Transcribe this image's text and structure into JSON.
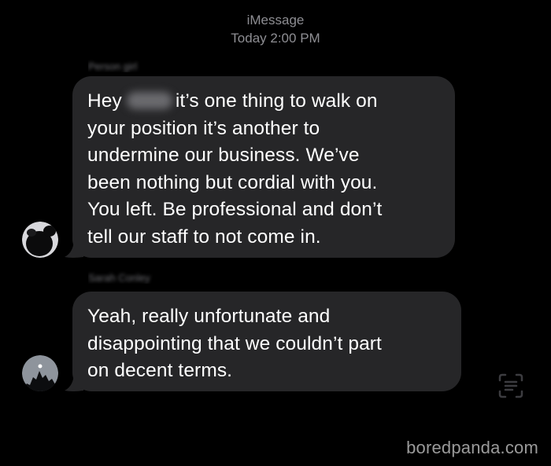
{
  "header": {
    "service": "iMessage",
    "timestamp": "Today 2:00 PM"
  },
  "messages": [
    {
      "sender_name": "Person girl",
      "lines": [
        "Hey",
        "it’s one thing to walk on",
        "your position it’s another to",
        "undermine our business. We’ve",
        "been nothing but cordial with you.",
        "You left. Be professional and don’t",
        "tell our staff to not come in."
      ],
      "has_redacted_name": true
    },
    {
      "sender_name": "Sarah Conley",
      "lines": [
        "Yeah, really unfortunate and",
        "disappointing that we couldn’t part",
        "on decent terms."
      ]
    }
  ],
  "icons": {
    "avatar_1": "avatar-icon",
    "avatar_2": "avatar-icon",
    "scan": "live-text-scan-icon"
  },
  "colors": {
    "background": "#000000",
    "bubble": "#262628",
    "meta_text": "#8e8e93",
    "message_text": "#ffffff"
  },
  "watermark": "boredpanda.com"
}
